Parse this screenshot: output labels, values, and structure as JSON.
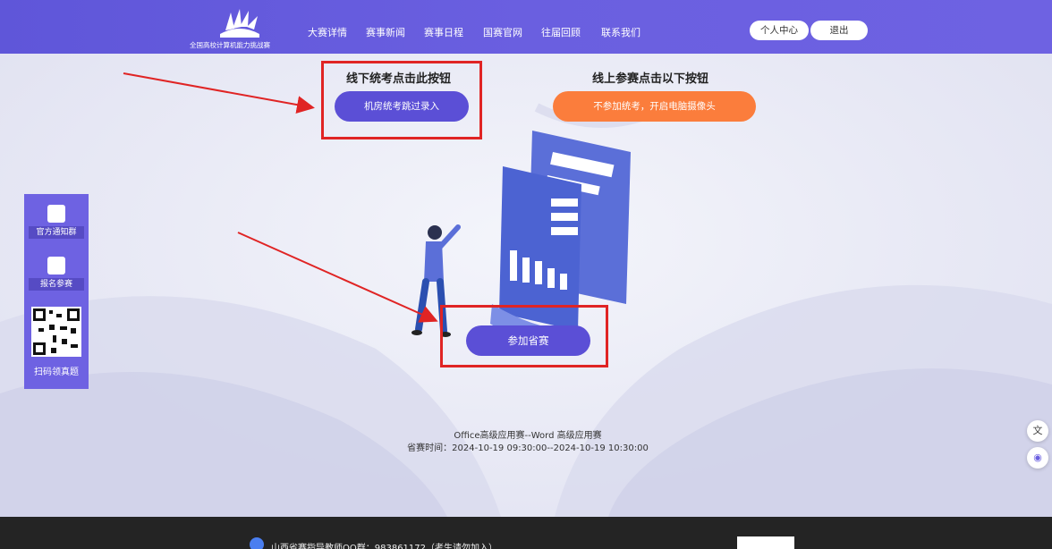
{
  "header": {
    "logo_text": "全国高校计算机能力挑战赛",
    "nav": [
      "大赛详情",
      "赛事新闻",
      "赛事日程",
      "国赛官网",
      "往届回顾",
      "联系我们"
    ],
    "profile_label": "个人中心",
    "logout_label": "退出"
  },
  "main": {
    "offline_title": "线下统考点击此按钮",
    "offline_button": "机房统考跳过录入",
    "online_title": "线上参赛点击以下按钮",
    "online_button": "不参加统考，开启电脑摄像头",
    "join_button": "参加省赛",
    "event_name": "Office高级应用赛--Word 高级应用赛",
    "event_time": "省赛时间：2024-10-19 09:30:00--2024-10-19 10:30:00"
  },
  "sidebar": {
    "items": [
      {
        "label": "官方通知群",
        "icon": "user-avatar-icon"
      },
      {
        "label": "报名参赛",
        "icon": "rocket-icon"
      }
    ],
    "scan_label": "扫码领真题"
  },
  "footer": {
    "qq_text": "山西省赛指导教师QQ群：983861172（考生请勿加入）"
  },
  "colors": {
    "brand": "#6a5fe0",
    "orange": "#fb7d3c",
    "annotation_red": "#e02424"
  }
}
